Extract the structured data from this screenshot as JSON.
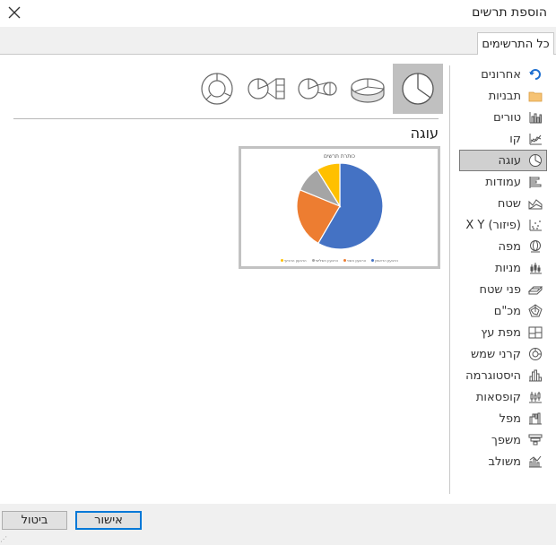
{
  "dialog": {
    "title": "הוספת תרשים",
    "tab_label": "כל התרשימים",
    "ok_label": "אישור",
    "cancel_label": "ביטול"
  },
  "sidebar": {
    "items": [
      {
        "label": "אחרונים",
        "icon": "recent-icon",
        "active": false
      },
      {
        "label": "תבניות",
        "icon": "folder-icon",
        "active": false
      },
      {
        "label": "טורים",
        "icon": "column-chart-icon",
        "active": false
      },
      {
        "label": "קו",
        "icon": "line-chart-icon",
        "active": false
      },
      {
        "label": "עוגה",
        "icon": "pie-chart-icon",
        "active": true
      },
      {
        "label": "עמודות",
        "icon": "bar-chart-icon",
        "active": false
      },
      {
        "label": "שטח",
        "icon": "area-chart-icon",
        "active": false
      },
      {
        "label": "X Y (פיזור)",
        "icon": "scatter-chart-icon",
        "active": false
      },
      {
        "label": "מפה",
        "icon": "map-chart-icon",
        "active": false
      },
      {
        "label": "מניות",
        "icon": "stock-chart-icon",
        "active": false
      },
      {
        "label": "פני שטח",
        "icon": "surface-chart-icon",
        "active": false
      },
      {
        "label": "מכ\"ם",
        "icon": "radar-chart-icon",
        "active": false
      },
      {
        "label": "מפת עץ",
        "icon": "treemap-chart-icon",
        "active": false
      },
      {
        "label": "קרני שמש",
        "icon": "sunburst-chart-icon",
        "active": false
      },
      {
        "label": "היסטוגרמה",
        "icon": "histogram-chart-icon",
        "active": false
      },
      {
        "label": "קופסאות",
        "icon": "box-whisker-chart-icon",
        "active": false
      },
      {
        "label": "מפל",
        "icon": "waterfall-chart-icon",
        "active": false
      },
      {
        "label": "משפך",
        "icon": "funnel-chart-icon",
        "active": false
      },
      {
        "label": "משולב",
        "icon": "combo-chart-icon",
        "active": false
      }
    ]
  },
  "main": {
    "section_title": "עוגה",
    "subtypes": [
      {
        "icon": "pie-subtype-icon",
        "selected": true
      },
      {
        "icon": "pie-3d-subtype-icon",
        "selected": false
      },
      {
        "icon": "pie-of-pie-subtype-icon",
        "selected": false
      },
      {
        "icon": "bar-of-pie-subtype-icon",
        "selected": false
      },
      {
        "icon": "doughnut-subtype-icon",
        "selected": false
      }
    ],
    "preview": {
      "title": "כותרת תרשים",
      "legend": [
        "הרבעון הראשון",
        "הרבעון השני",
        "הרבעון השלישי",
        "הרבעון הרביעי"
      ]
    }
  },
  "chart_data": {
    "type": "pie",
    "title": "כותרת תרשים",
    "categories": [
      "הרבעון הראשון",
      "הרבעון השני",
      "הרבעון השלישי",
      "הרבעון הרביעי"
    ],
    "values": [
      59,
      23,
      10,
      9
    ],
    "colors": [
      "#4472c4",
      "#ed7d31",
      "#a5a5a5",
      "#ffc000"
    ]
  }
}
